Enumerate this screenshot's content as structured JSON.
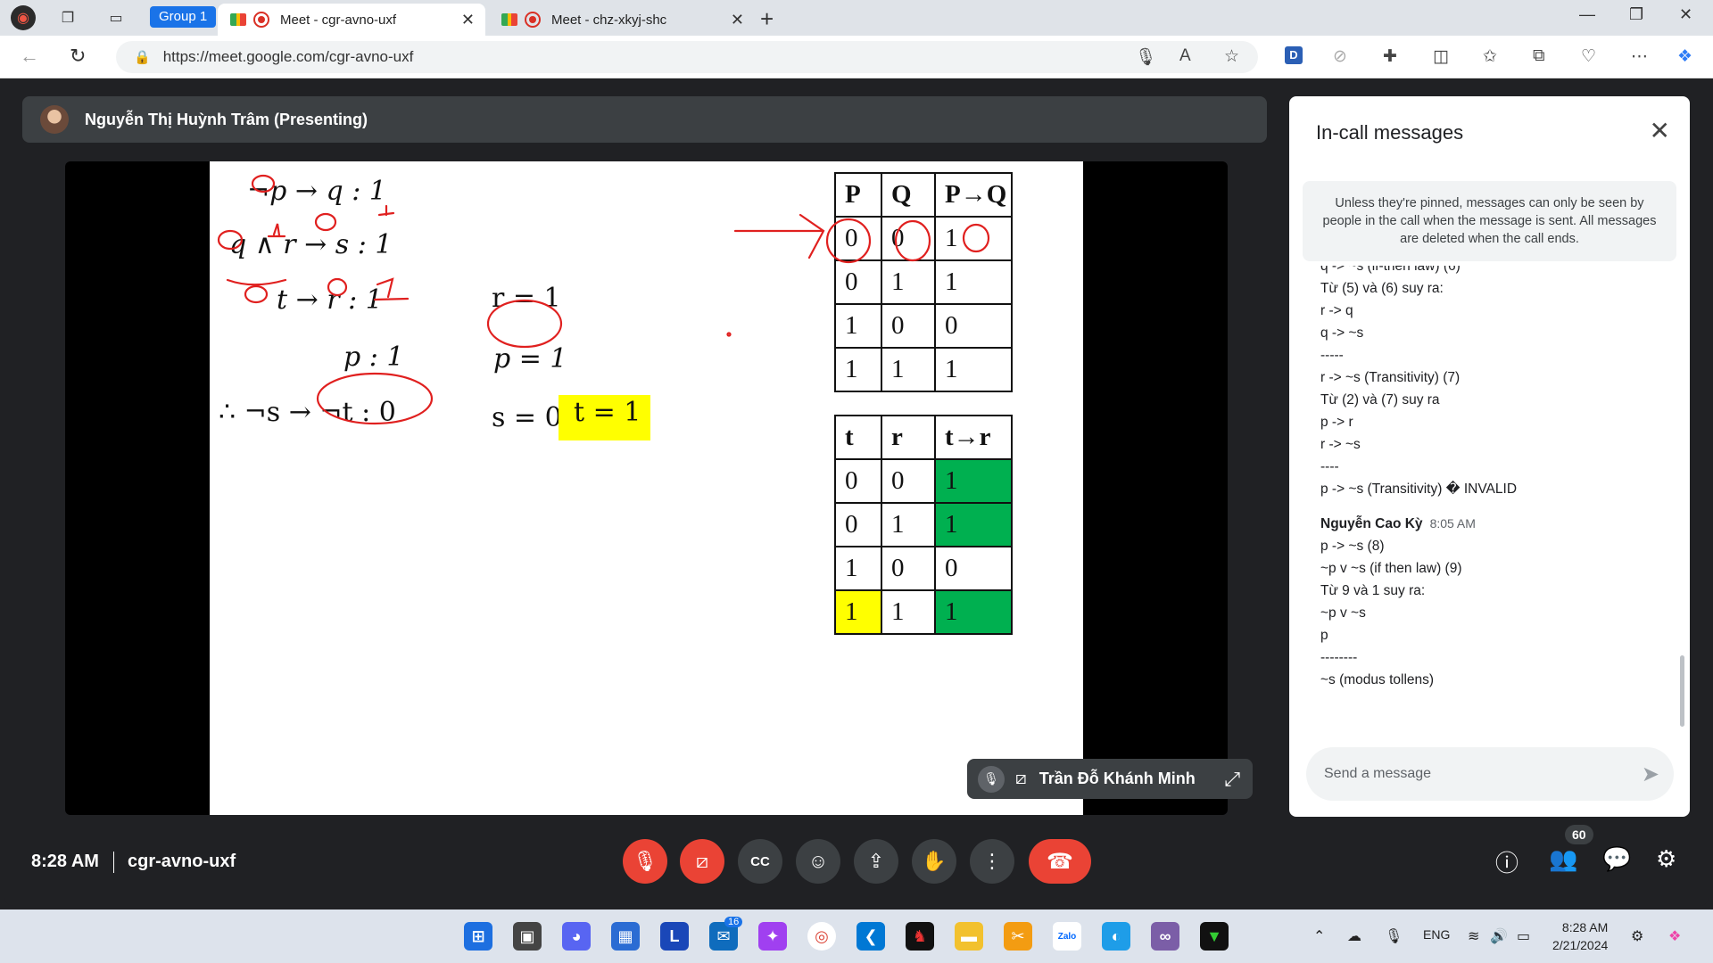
{
  "browser": {
    "group_label": "Group 1",
    "tabs": [
      {
        "title": "Meet - cgr-avno-uxf",
        "active": true
      },
      {
        "title": "Meet - chz-xkyj-shc",
        "active": false
      }
    ],
    "url": "https://meet.google.com/cgr-avno-uxf",
    "icons": [
      "app-icon",
      "workspaces-icon",
      "tab-actions-icon",
      "new-tab-icon",
      "minimize-icon",
      "maximize-icon",
      "close-icon",
      "back-icon",
      "reload-icon",
      "lock-icon",
      "mic-icon",
      "read-aloud-icon",
      "favorite-icon",
      "extension-d-icon",
      "compass-icon",
      "extensions-icon",
      "split-screen-icon",
      "favorites-icon",
      "collections-icon",
      "performance-icon",
      "more-icon",
      "copilot-icon"
    ]
  },
  "meet": {
    "presenter": "Nguyễn Thị Huỳnh Trâm (Presenting)",
    "slide": {
      "lines": [
        {
          "id": "l1",
          "text": "¬p → q   : 1"
        },
        {
          "id": "l2",
          "text": "q ∧ r → s   : 1"
        },
        {
          "id": "l3",
          "text": "t → r   : 1"
        },
        {
          "id": "l4",
          "text": "r = 1"
        },
        {
          "id": "l5",
          "text": "p : 1"
        },
        {
          "id": "l6",
          "text": "p = 1"
        },
        {
          "id": "l7",
          "text": "∴ ¬s → ¬t   : 0"
        },
        {
          "id": "l8",
          "text": "s = 0"
        },
        {
          "id": "l9",
          "text": "t  = 1"
        }
      ],
      "table1": {
        "header": [
          "P",
          "Q",
          "P→Q"
        ],
        "rows": [
          [
            "0",
            "0",
            "1"
          ],
          [
            "0",
            "1",
            "1"
          ],
          [
            "1",
            "0",
            "0"
          ],
          [
            "1",
            "1",
            "1"
          ]
        ]
      },
      "table2": {
        "header": [
          "t",
          "r",
          "t→r"
        ],
        "rows": [
          [
            "0",
            "0",
            "1"
          ],
          [
            "0",
            "1",
            "1"
          ],
          [
            "1",
            "0",
            "0"
          ],
          [
            "1",
            "1",
            "1"
          ]
        ]
      },
      "colors": {
        "green": "#00b050",
        "yellow": "#ffff00",
        "ink_red": "#e0201f"
      }
    },
    "tile_name": "Trần Đỗ Khánh Minh",
    "time": "8:28 AM",
    "meeting_code": "cgr-avno-uxf",
    "participants_count": "60"
  },
  "panel": {
    "title": "In-call messages",
    "notice": "Unless they're pinned, messages can only be seen by people in the call when the message is sent. All messages are deleted when the call ends.",
    "messages_top": [
      "q -> ~s (if-then law) (6)",
      "Từ (5) và (6) suy ra:",
      "r -> q",
      "q -> ~s",
      "-----",
      "r -> ~s (Transitivity) (7)",
      "Từ (2) và (7) suy ra",
      "p -> r",
      "r -> ~s",
      "----",
      "p -> ~s (Transitivity) � INVALID"
    ],
    "sender": "Nguyễn Cao Kỳ",
    "sender_time": "8:05 AM",
    "messages_bottom": [
      "p -> ~s (8)",
      "~p v ~s (if then law) (9)",
      "Từ 9 và 1 suy ra:",
      "~p v ~s",
      "p",
      "--------",
      "~s (modus tollens)"
    ],
    "send_placeholder": "Send a message"
  },
  "taskbar": {
    "badge_count": "16",
    "lang": "ENG",
    "clock_time": "8:28 AM",
    "clock_date": "2/21/2024"
  }
}
